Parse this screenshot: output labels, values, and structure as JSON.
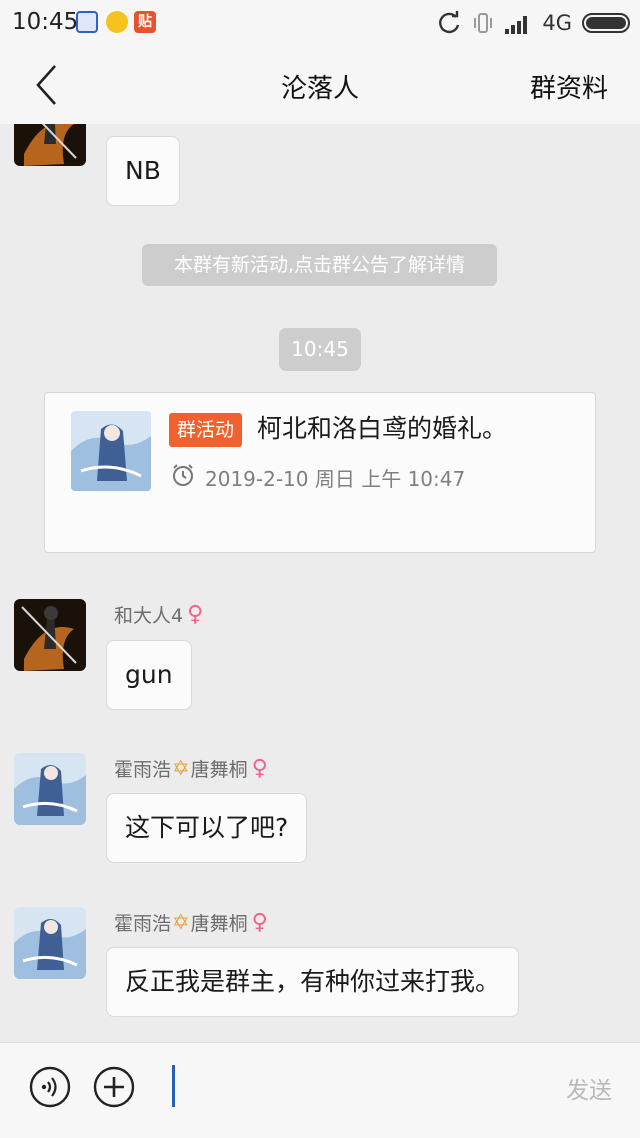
{
  "status_bar": {
    "time": "10:45",
    "network": "4G",
    "app_icons": [
      "blue-app-icon",
      "yellow-app-icon",
      "tieba-app-icon"
    ],
    "tieba_label": "贴",
    "right_icons": [
      "sync-icon",
      "vibrate-icon",
      "signal-icon",
      "battery-icon"
    ]
  },
  "header": {
    "title": "沦落人",
    "right_action": "群资料",
    "back_icon": "back-arrow-icon"
  },
  "chat": {
    "messages": [
      {
        "sender": "",
        "text": "NB"
      },
      {
        "system_notice": "本群有新活动,点击群公告了解详情"
      },
      {
        "time": "10:45"
      },
      {
        "event_card": {
          "tag": "群活动",
          "title": "柯北和洛白鸢的婚礼。",
          "datetime": "2019-2-10 周日 上午 10:47"
        }
      },
      {
        "sender_name": "和大人4",
        "gender": "♀",
        "text": "gun"
      },
      {
        "sender_name_a": "霍雨浩",
        "sender_star": "✡",
        "sender_name_b": "唐舞桐",
        "gender": "♀",
        "text": "这下可以了吧?"
      },
      {
        "sender_name_a": "霍雨浩",
        "sender_star": "✡",
        "sender_name_b": "唐舞桐",
        "gender": "♀",
        "text": "反正我是群主，有种你过来打我。"
      }
    ]
  },
  "input_bar": {
    "value": "",
    "send_label": "发送",
    "icons": [
      "voice-icon",
      "plus-icon"
    ]
  },
  "colors": {
    "event_tag": "#f0612e",
    "female_symbol": "#f0638a",
    "star_symbol": "#e9a23b",
    "caret": "#2a5fb8"
  }
}
